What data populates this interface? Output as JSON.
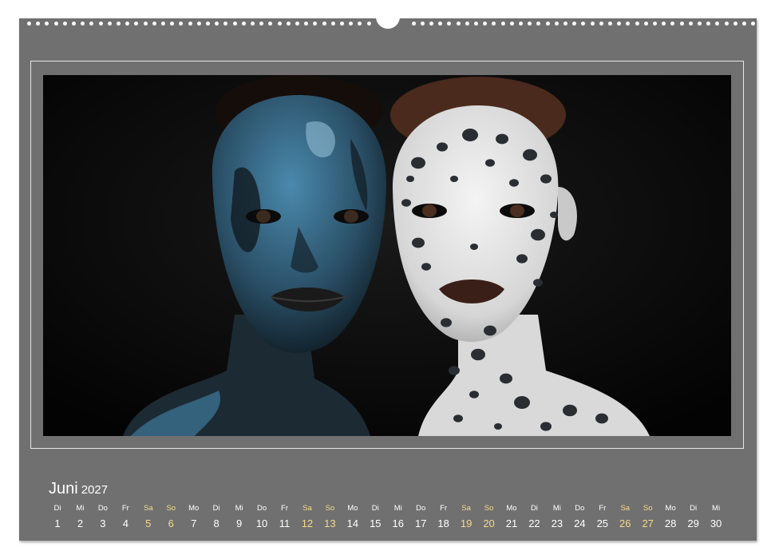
{
  "calendar": {
    "month": "Juni",
    "year": "2027",
    "days": [
      {
        "name": "Di",
        "num": "1",
        "weekend": false
      },
      {
        "name": "Mi",
        "num": "2",
        "weekend": false
      },
      {
        "name": "Do",
        "num": "3",
        "weekend": false
      },
      {
        "name": "Fr",
        "num": "4",
        "weekend": false
      },
      {
        "name": "Sa",
        "num": "5",
        "weekend": true
      },
      {
        "name": "So",
        "num": "6",
        "weekend": true
      },
      {
        "name": "Mo",
        "num": "7",
        "weekend": false
      },
      {
        "name": "Di",
        "num": "8",
        "weekend": false
      },
      {
        "name": "Mi",
        "num": "9",
        "weekend": false
      },
      {
        "name": "Do",
        "num": "10",
        "weekend": false
      },
      {
        "name": "Fr",
        "num": "11",
        "weekend": false
      },
      {
        "name": "Sa",
        "num": "12",
        "weekend": true
      },
      {
        "name": "So",
        "num": "13",
        "weekend": true
      },
      {
        "name": "Mo",
        "num": "14",
        "weekend": false
      },
      {
        "name": "Di",
        "num": "15",
        "weekend": false
      },
      {
        "name": "Mi",
        "num": "16",
        "weekend": false
      },
      {
        "name": "Do",
        "num": "17",
        "weekend": false
      },
      {
        "name": "Fr",
        "num": "18",
        "weekend": false
      },
      {
        "name": "Sa",
        "num": "19",
        "weekend": true
      },
      {
        "name": "So",
        "num": "20",
        "weekend": true
      },
      {
        "name": "Mo",
        "num": "21",
        "weekend": false
      },
      {
        "name": "Di",
        "num": "22",
        "weekend": false
      },
      {
        "name": "Mi",
        "num": "23",
        "weekend": false
      },
      {
        "name": "Do",
        "num": "24",
        "weekend": false
      },
      {
        "name": "Fr",
        "num": "25",
        "weekend": false
      },
      {
        "name": "Sa",
        "num": "26",
        "weekend": true
      },
      {
        "name": "So",
        "num": "27",
        "weekend": true
      },
      {
        "name": "Mo",
        "num": "28",
        "weekend": false
      },
      {
        "name": "Di",
        "num": "29",
        "weekend": false
      },
      {
        "name": "Mi",
        "num": "30",
        "weekend": false
      }
    ]
  },
  "colors": {
    "page": "#707070",
    "weekend": "#f5d98a",
    "weekday": "#ffffff",
    "photo_background": "#060606",
    "blue_paint": "#3f7a9c",
    "white_paint": "#e9e9e9"
  },
  "photo": {
    "icon": "portrait-illustration"
  }
}
